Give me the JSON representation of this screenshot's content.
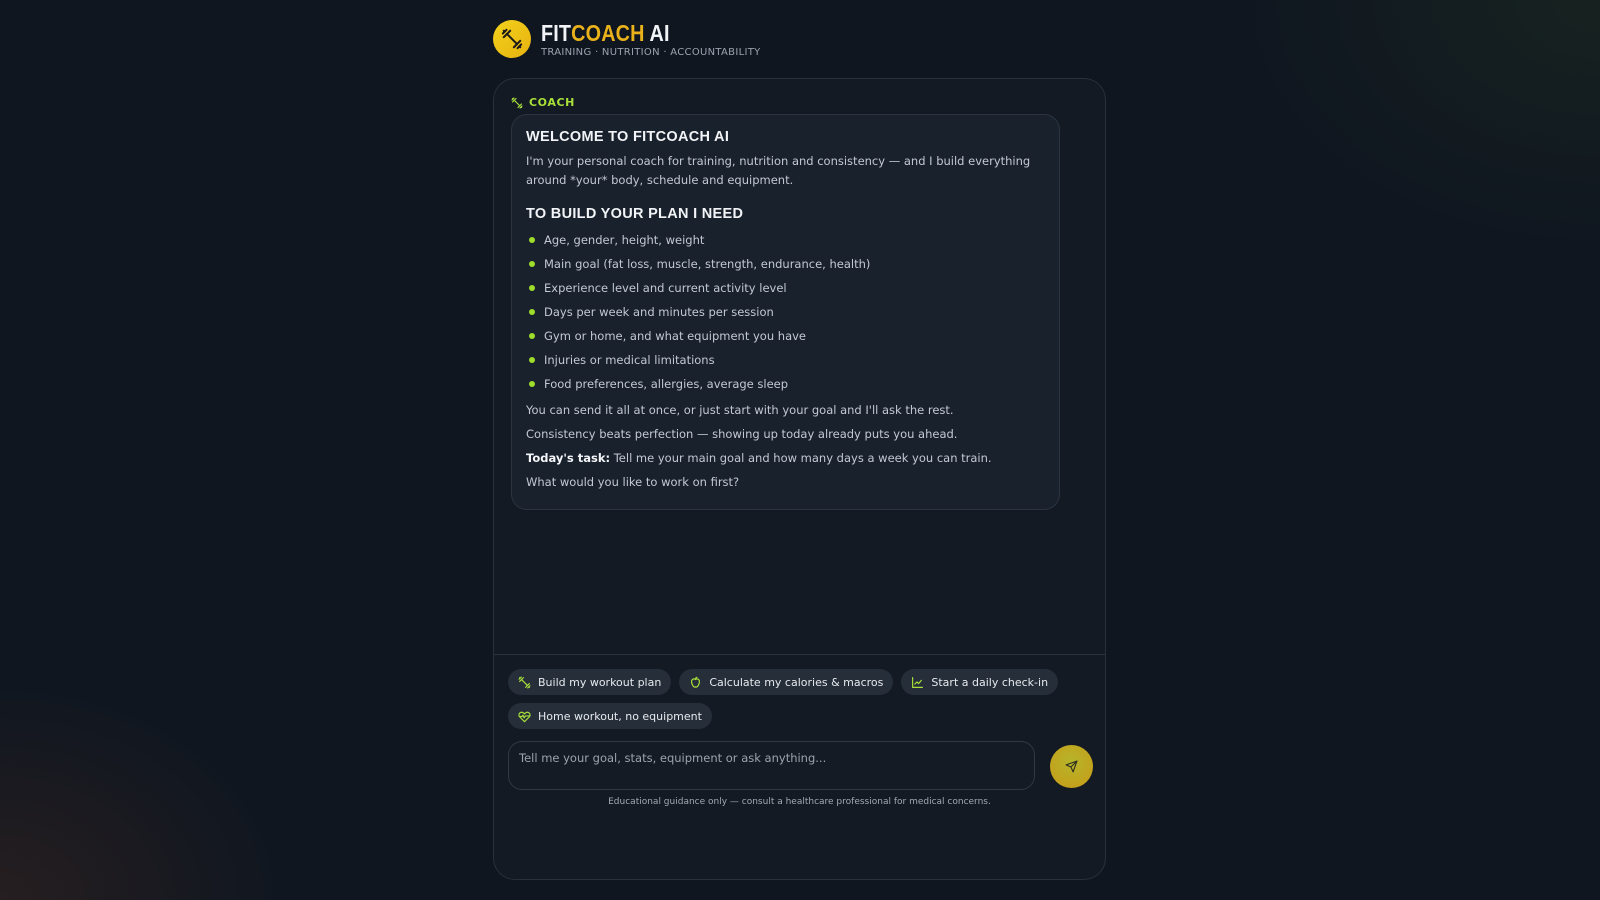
{
  "brand": {
    "title_part1": "FIT",
    "title_part2": "COACH",
    "title_part3": " AI",
    "subtitle": "TRAINING · NUTRITION · ACCOUNTABILITY"
  },
  "message": {
    "sender": "COACH",
    "heading": "WELCOME TO FITCOACH AI",
    "intro": "I'm your personal coach for training, nutrition and consistency — and I build everything around *your* body, schedule and equipment.",
    "requirements_title": "TO BUILD YOUR PLAN I NEED",
    "requirements": [
      "Age, gender, height, weight",
      "Main goal (fat loss, muscle, strength, endurance, health)",
      "Experience level and current activity level",
      "Days per week and minutes per session",
      "Gym or home, and what equipment you have",
      "Injuries or medical limitations",
      "Food preferences, allergies, average sleep"
    ],
    "line1": "You can send it all at once, or just start with your goal and I'll ask the rest.",
    "line2": "Consistency beats perfection — showing up today already puts you ahead.",
    "task_label": "Today's task:",
    "task_text": " Tell me your main goal and how many days a week you can train.",
    "question": "What would you like to work on first?"
  },
  "quick_actions": [
    {
      "label": "Build my workout plan",
      "icon": "dumbbell-icon"
    },
    {
      "label": "Calculate my calories & macros",
      "icon": "apple-icon"
    },
    {
      "label": "Start a daily check-in",
      "icon": "chart-line-icon"
    },
    {
      "label": "Home workout, no equipment",
      "icon": "heart-pulse-icon"
    }
  ],
  "composer": {
    "placeholder": "Tell me your goal, stats, equipment or ask anything..."
  },
  "disclaimer": "Educational guidance only — consult a healthcare professional for medical concerns.",
  "colors": {
    "accent_green": "#a8e03a",
    "accent_gold": "#e9b11a",
    "background": "#0f1620"
  }
}
